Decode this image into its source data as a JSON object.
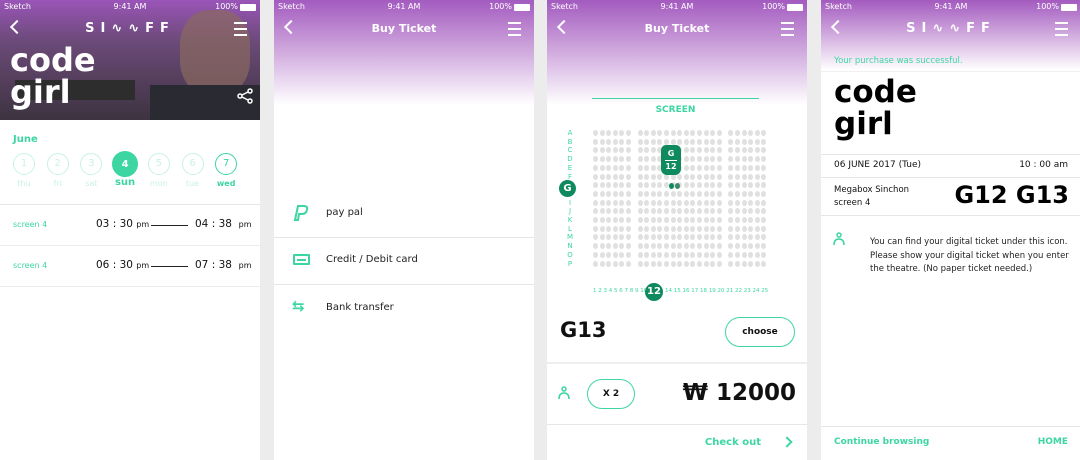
{
  "status": {
    "carrier": "Sketch",
    "time": "9:41 AM",
    "battery": "100%"
  },
  "brand": "SI∿∿FF",
  "colors": {
    "accent": "#3dd6a3",
    "marker": "#0f8a5f",
    "header": "#a35bbf"
  },
  "screen1": {
    "title_line1": "code",
    "title_line2": "girl",
    "month": "June",
    "days": [
      {
        "num": "1",
        "label": "thu"
      },
      {
        "num": "2",
        "label": "fri"
      },
      {
        "num": "3",
        "label": "sat"
      },
      {
        "num": "4",
        "label": "sun",
        "selected": true
      },
      {
        "num": "5",
        "label": "mon"
      },
      {
        "num": "6",
        "label": "tue"
      },
      {
        "num": "7",
        "label": "wed",
        "highlight": true
      }
    ],
    "showtimes": [
      {
        "screen": "screen 4",
        "start": "03 : 30",
        "start_ampm": "pm",
        "end": "04 : 38",
        "end_ampm": "pm"
      },
      {
        "screen": "screen 4",
        "start": "06 : 30",
        "start_ampm": "pm",
        "end": "07 : 38",
        "end_ampm": "pm"
      }
    ]
  },
  "screen2": {
    "title": "Buy Ticket",
    "methods": [
      {
        "icon": "paypal-icon",
        "label": "pay pal"
      },
      {
        "icon": "credit-card-icon",
        "label": "Credit / Debit card"
      },
      {
        "icon": "transfer-icon",
        "label": "Bank transfer"
      }
    ]
  },
  "screen3": {
    "title": "Buy Ticket",
    "screen_label": "SCREEN",
    "rows": [
      "A",
      "B",
      "C",
      "D",
      "E",
      "F",
      "G",
      "H",
      "I",
      "J",
      "K",
      "L",
      "M",
      "N",
      "O",
      "P"
    ],
    "selected_row": "G",
    "selected_col": "12",
    "columns_before": "1 2 3 4 5 6 7 8 9 10 1",
    "columns_after": "14 15 16 17 18 19 20 21 22 23 24 25",
    "marker_row": "G",
    "marker_col": "12",
    "seat": "G13",
    "choose": "choose",
    "quantity": "X 2",
    "price": "₩ 12000",
    "checkout": "Check out"
  },
  "screen4": {
    "success": "Your purchase was successful.",
    "title_line1": "code",
    "title_line2": "girl",
    "date": "06 JUNE 2017 (Tue)",
    "time": "10 : 00 am",
    "venue": "Megabox Sinchon",
    "screen": "screen 4",
    "seats": "G12 G13",
    "info": "You can find your digital ticket under this icon. Please show your digital ticket when you enter the theatre. (No paper ticket needed.)",
    "continue": "Continue browsing",
    "home": "HOME"
  }
}
